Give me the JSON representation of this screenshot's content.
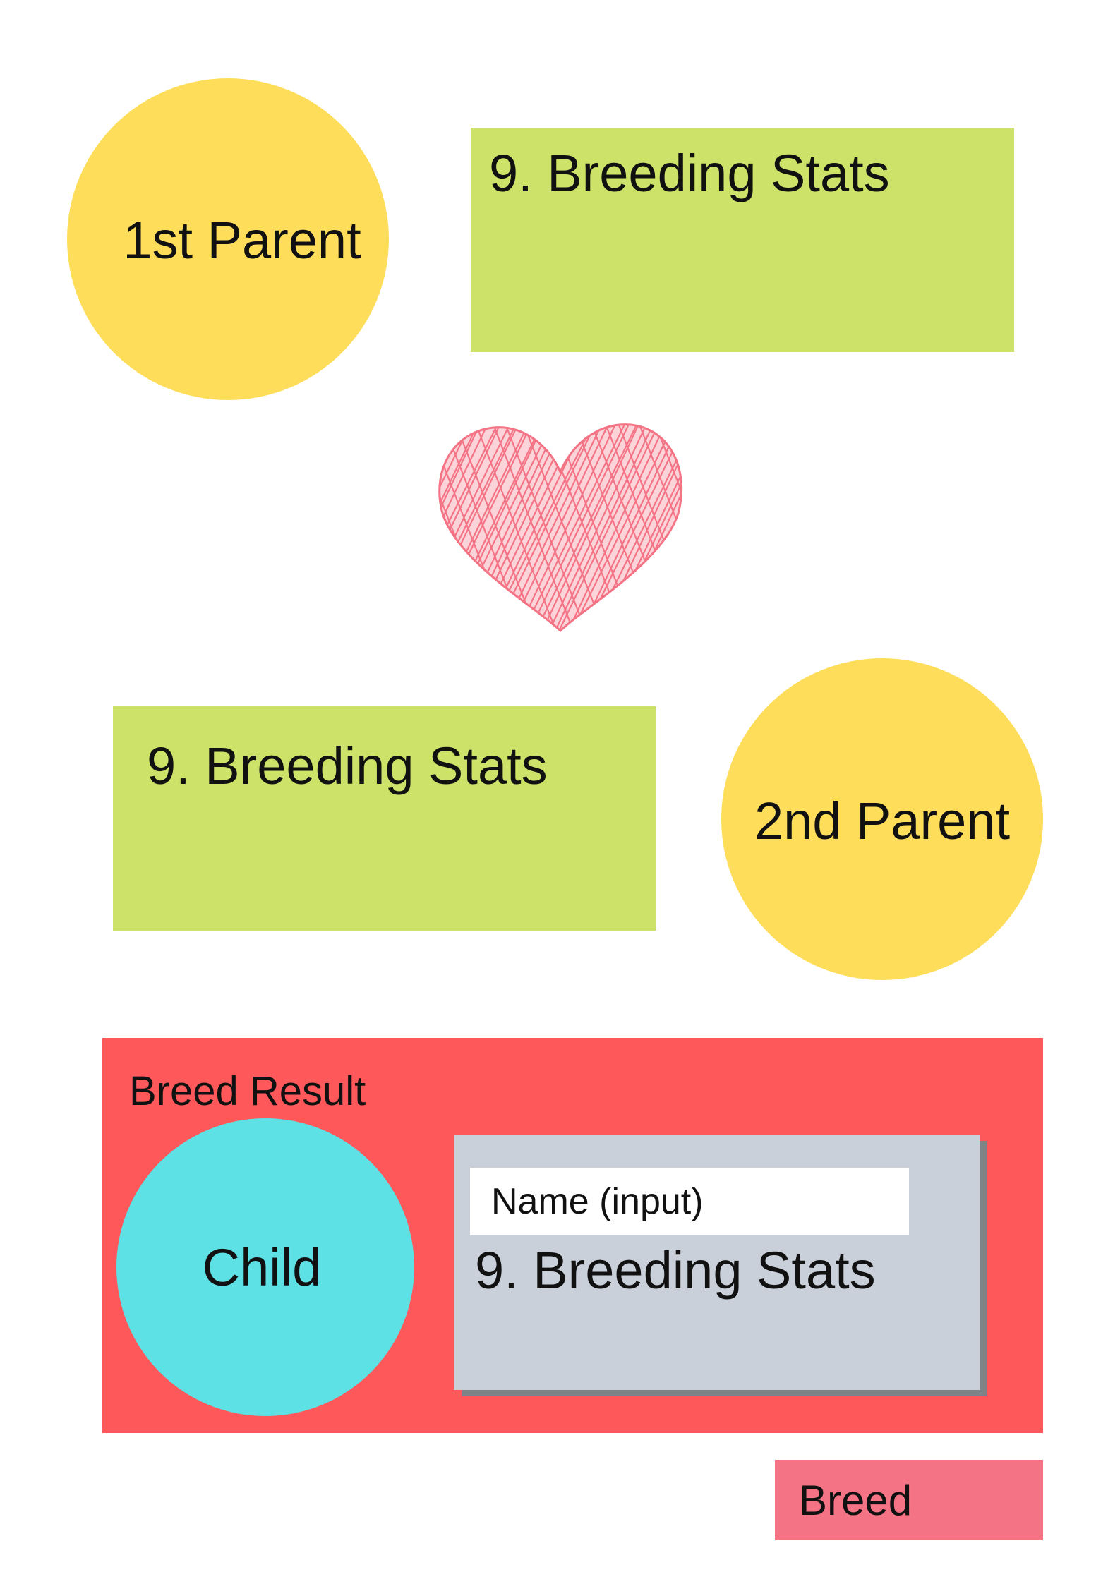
{
  "parent1": {
    "label": "1st Parent",
    "stats_label": "9. Breeding Stats"
  },
  "parent2": {
    "label": "2nd Parent",
    "stats_label": "9. Breeding Stats"
  },
  "heart": {
    "icon": "heart-icon",
    "color": "#F47385"
  },
  "result": {
    "title": "Breed Result",
    "child_label": "Child",
    "name_input": "Name (input)",
    "stats_label": "9. Breeding Stats"
  },
  "actions": {
    "breed_label": "Breed"
  },
  "colors": {
    "parent_circle": "#FEDD5A",
    "stats_box": "#CCE268",
    "result_panel": "#FE585A",
    "child_circle": "#5DE1E5",
    "card": "#C9D0D9",
    "breed_button": "#F47385"
  }
}
